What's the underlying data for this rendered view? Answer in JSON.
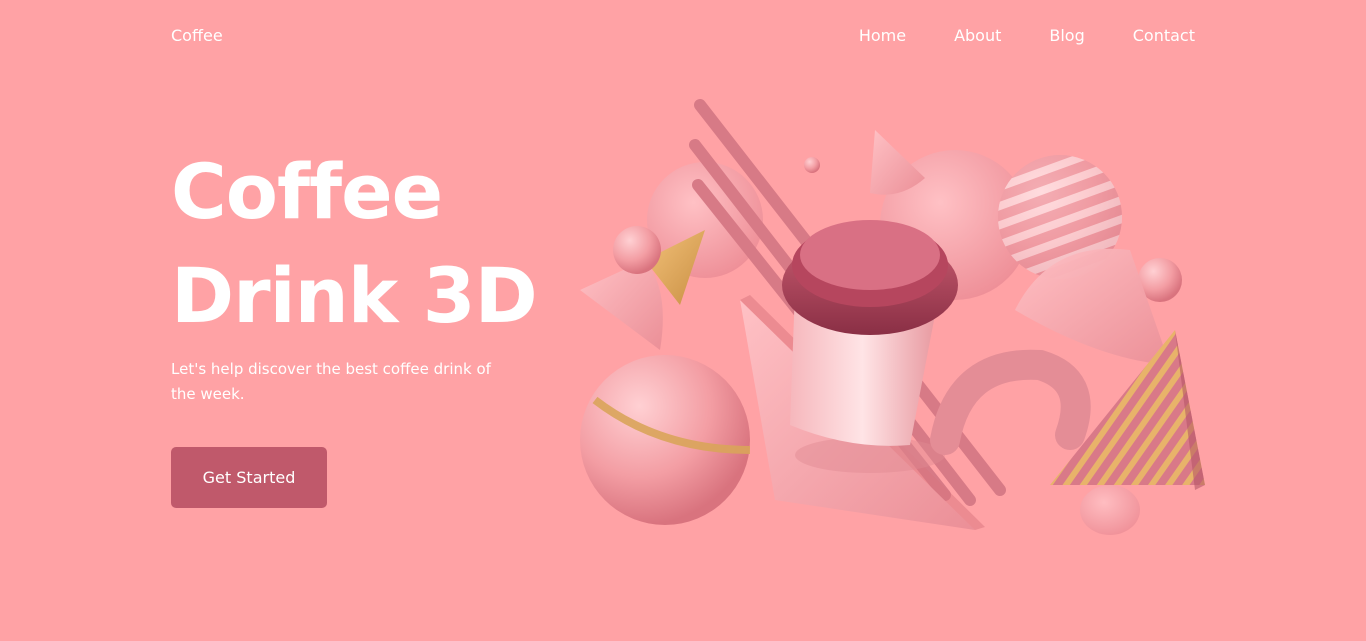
{
  "header": {
    "logo": "Coffee",
    "nav": [
      "Home",
      "About",
      "Blog",
      "Contact"
    ]
  },
  "hero": {
    "title_line1": "Coffee",
    "title_line2": "Drink 3D",
    "subtitle": "Let's help discover the best coffee drink of the week.",
    "cta_label": "Get Started"
  },
  "colors": {
    "background": "#ffa2a5",
    "button": "#c0596b",
    "text": "#ffffff",
    "accent_gold": "#d9a45a"
  },
  "illustration": {
    "icon": "coffee-cup-3d-shapes-illustration"
  }
}
